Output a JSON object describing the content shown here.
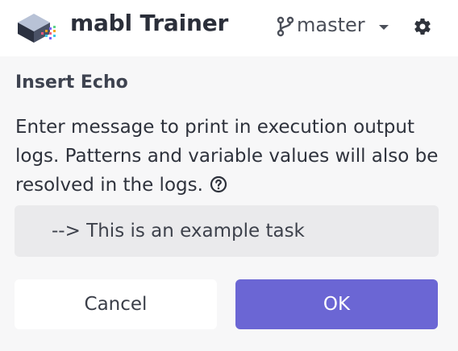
{
  "header": {
    "app_title": "mabl Trainer",
    "branch": "master",
    "icons": [
      "mabl-logo-icon",
      "branch-icon",
      "caret-down-icon",
      "gear-icon"
    ]
  },
  "step": {
    "title": "Insert Echo",
    "description": "Enter message to print in execution output logs. Patterns and variable values will also be resolved in the logs.",
    "help_icon": "question-circle-icon"
  },
  "echo_input": {
    "value": "--> This is an example task"
  },
  "actions": {
    "cancel_label": "Cancel",
    "ok_label": "OK"
  },
  "colors": {
    "accent": "#6b66d4",
    "background": "#f7f7f8",
    "input_background": "#eaeaec"
  }
}
